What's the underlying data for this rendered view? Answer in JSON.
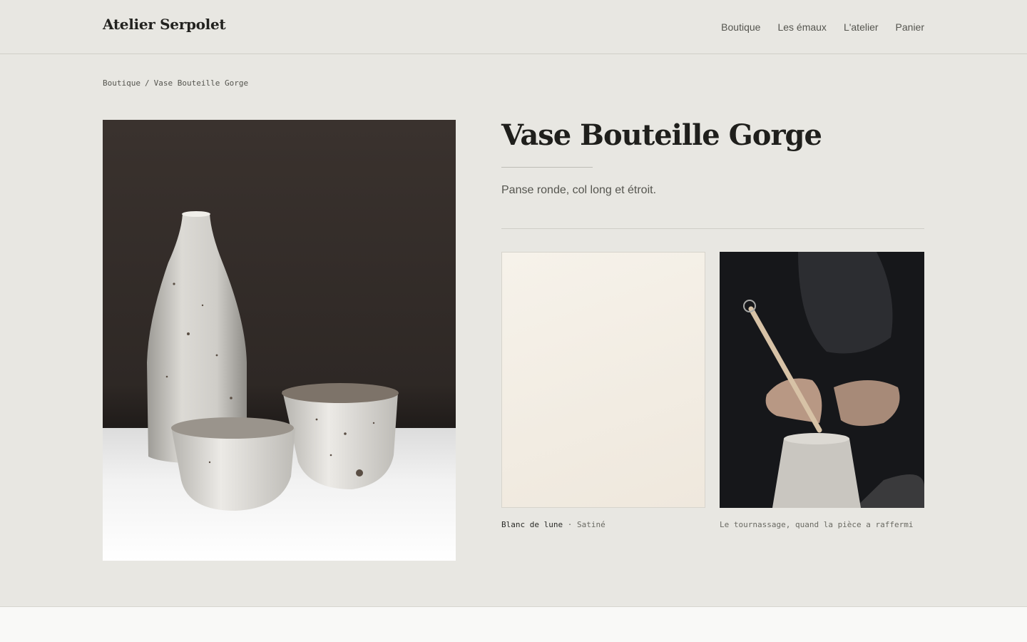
{
  "header": {
    "logo": "Atelier Serpolet",
    "nav": [
      "Boutique",
      "Les émaux",
      "L'atelier",
      "Panier"
    ]
  },
  "breadcrumb": {
    "items": [
      "Boutique",
      "Vase Bouteille Gorge"
    ],
    "separator": "/"
  },
  "product": {
    "title": "Vase Bouteille Gorge",
    "description": "Panse ronde, col long et étroit."
  },
  "swatch": {
    "name": "Blanc de lune",
    "separator": "·",
    "finish": "Satiné",
    "color": "#f2ece2"
  },
  "workshop": {
    "caption": "Le tournassage, quand la pièce a raffermi"
  }
}
